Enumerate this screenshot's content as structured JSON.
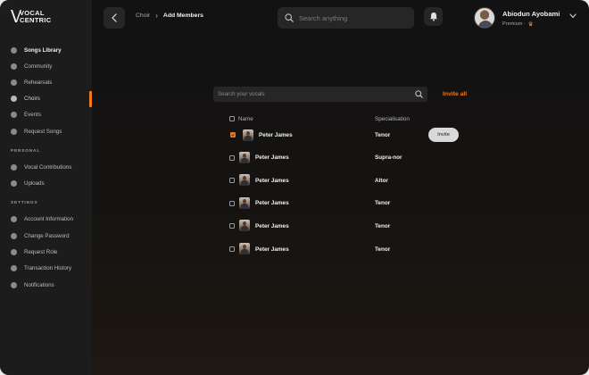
{
  "app": {
    "logo_text": "VOCAL CENTRIC",
    "accent_color": "#f27a1a"
  },
  "sidebar": {
    "items": [
      {
        "label": "Songs Library",
        "icon": "music-library-icon"
      },
      {
        "label": "Community",
        "icon": "community-icon"
      },
      {
        "label": "Rehearsals",
        "icon": "rehearsals-icon"
      },
      {
        "label": "Choirs",
        "icon": "choirs-icon"
      },
      {
        "label": "Events",
        "icon": "events-icon"
      },
      {
        "label": "Request Songs",
        "icon": "request-songs-icon"
      }
    ],
    "personal_heading": "PERSONAL",
    "personal_items": [
      {
        "label": "Vocal Contributions",
        "icon": "microphone-icon"
      },
      {
        "label": "Uploads",
        "icon": "upload-icon"
      }
    ],
    "settings_heading": "SETTINGS",
    "settings_items": [
      {
        "label": "Account Information",
        "icon": "account-icon"
      },
      {
        "label": "Change Password",
        "icon": "lock-icon"
      },
      {
        "label": "Request Role",
        "icon": "role-icon"
      },
      {
        "label": "Transaction History",
        "icon": "history-icon"
      },
      {
        "label": "Notifications",
        "icon": "notification-icon"
      }
    ]
  },
  "header": {
    "breadcrumb": [
      "Choir",
      "Add Members"
    ],
    "search_placeholder": "Search anything",
    "user_name": "Abiodun Ayobami",
    "user_plan": "Premium ·"
  },
  "main": {
    "vocal_search_placeholder": "Search your vocals",
    "invite_all_label": "Invite all",
    "columns": [
      "Name",
      "Specialisation"
    ],
    "invite_button_label": "Invite",
    "rows": [
      {
        "name": "Peter James",
        "specialisation": "Tenor",
        "checked": true
      },
      {
        "name": "Peter James",
        "specialisation": "Supra-nor",
        "checked": false
      },
      {
        "name": "Peter James",
        "specialisation": "Altor",
        "checked": false
      },
      {
        "name": "Peter James",
        "specialisation": "Tenor",
        "checked": false
      },
      {
        "name": "Peter James",
        "specialisation": "Tenor",
        "checked": false
      },
      {
        "name": "Peter James",
        "specialisation": "Tenor",
        "checked": false
      }
    ]
  }
}
